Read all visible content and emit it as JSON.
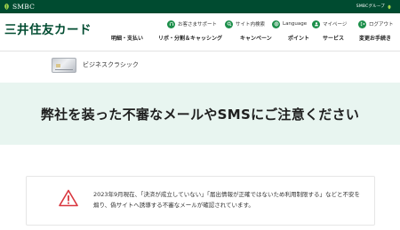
{
  "topbar": {
    "logo_text": "SMBC",
    "group_text": "SMBCグループ",
    "logo_icon": "smbc-leaf-icon"
  },
  "header": {
    "brand": "三井住友カード",
    "utility": [
      {
        "label": "お客さまサポート",
        "icon": "support-icon"
      },
      {
        "label": "サイト内検索",
        "icon": "search-icon"
      },
      {
        "label": "Language",
        "icon": "globe-icon"
      },
      {
        "label": "マイページ",
        "icon": "user-icon"
      },
      {
        "label": "ログアウト",
        "icon": "logout-icon"
      }
    ],
    "nav": [
      {
        "label": "明細・支払い"
      },
      {
        "label": "リボ・分割＆キャッシング"
      },
      {
        "label": "キャンペーン"
      },
      {
        "label": "ポイント"
      },
      {
        "label": "サービス"
      },
      {
        "label": "変更お手続き"
      }
    ]
  },
  "card": {
    "name": "ビジネスクラシック"
  },
  "page": {
    "title": "弊社を装った不審なメールやSMSにご注意ください"
  },
  "notice": {
    "icon": "warning-icon",
    "text": "2023年9月現在、「決済が成立していない」「届出情報が正確ではないため利用制限する」などと不安を煽り、偽サイトへ誘導する不審なメールが確認されています。"
  },
  "colors": {
    "brand_green": "#004b30",
    "accent_green": "#1c8f4a",
    "band_bg": "#e8f5f0",
    "warning_red": "#d9363e"
  }
}
